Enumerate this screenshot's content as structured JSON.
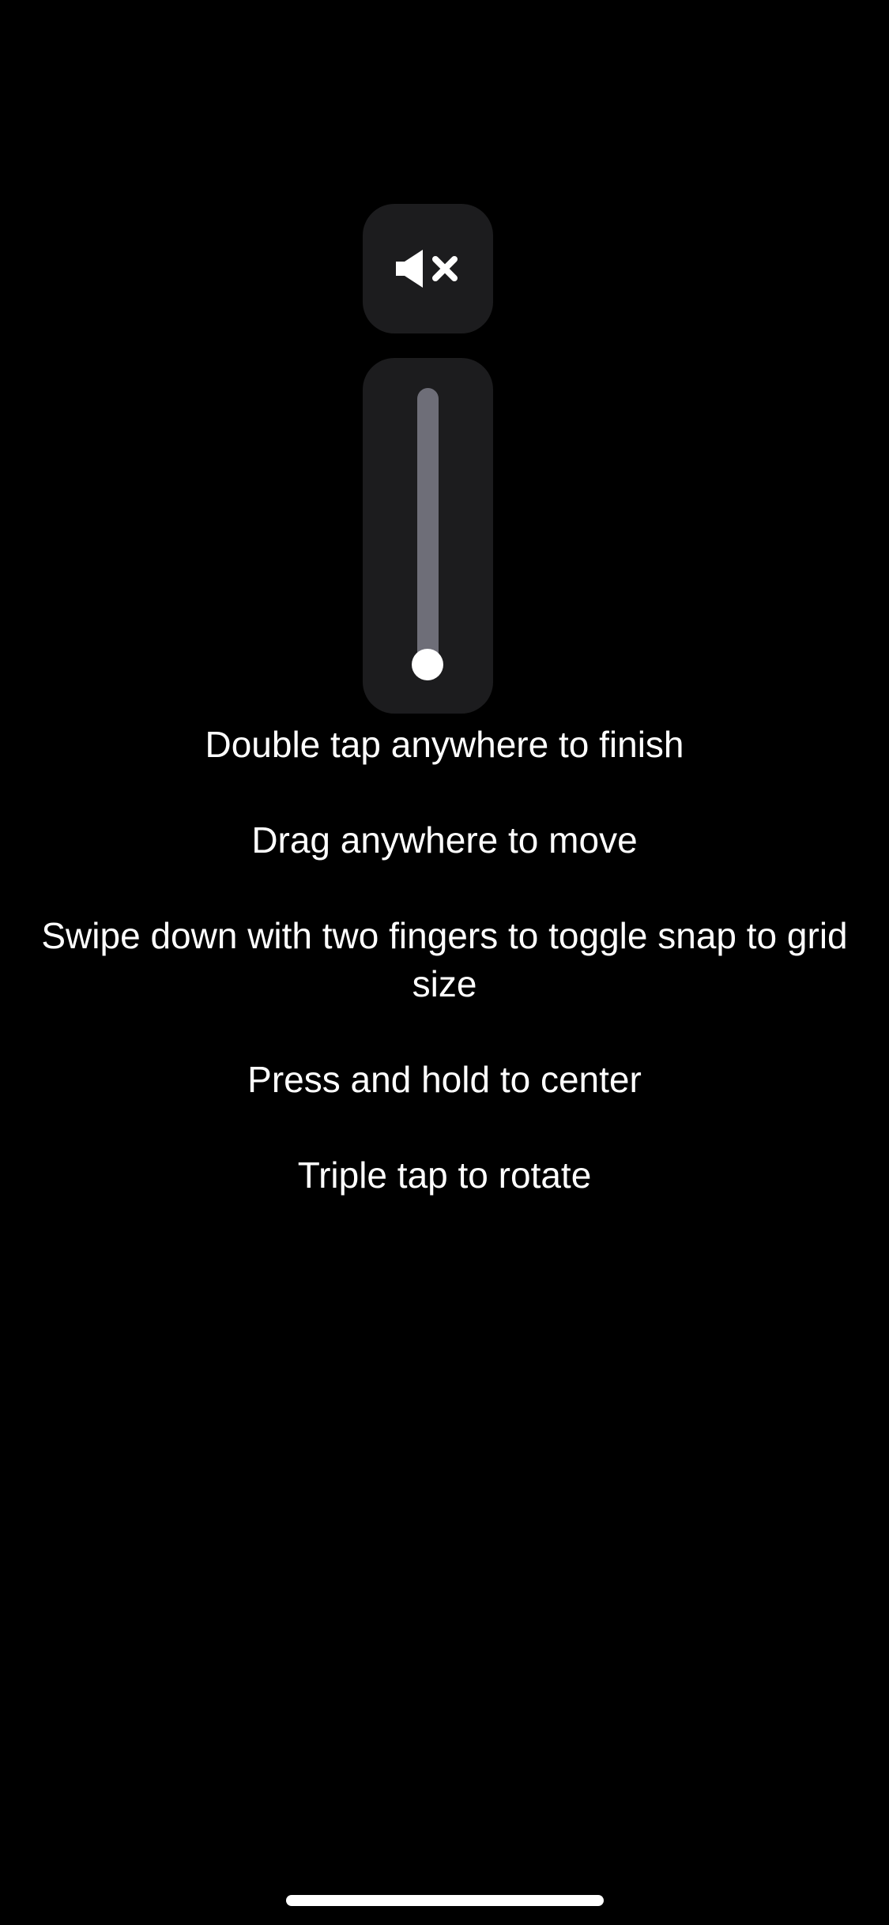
{
  "mute_button": {
    "icon": "speaker-mute-icon",
    "muted": true
  },
  "volume_slider": {
    "level": 0.0,
    "track_color": "#6e6e78",
    "thumb_color": "#ffffff"
  },
  "instructions": [
    "Double tap anywhere to finish",
    "Drag anywhere to move",
    "Swipe down with two fingers to toggle snap to grid size",
    "Press and hold to center",
    "Triple tap to rotate"
  ],
  "colors": {
    "background": "#000000",
    "tile": "#1c1c1e",
    "text": "#ffffff"
  }
}
